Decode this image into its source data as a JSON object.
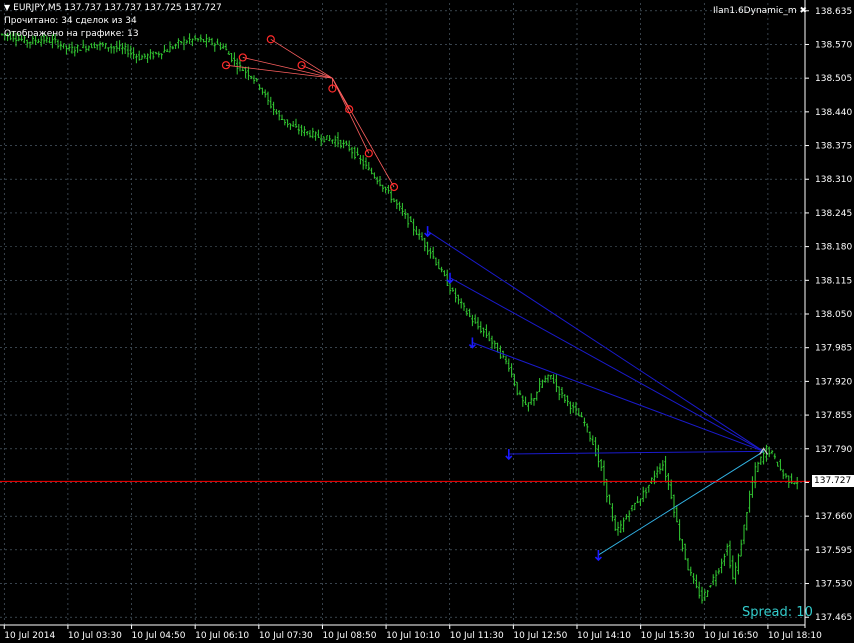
{
  "header": {
    "symbol_info": "EURJPY,M5  137.737 137.737 137.725 137.727",
    "read_info": "Прочитано: 34 сделок из 34",
    "shown_info": "Отображено на графике: 13",
    "ea_name": "Ilan1.6Dynamic_m",
    "close_symbol": "✖",
    "triangle_symbol": "▼"
  },
  "spread_text": "Spread: 10",
  "colors": {
    "background": "#000000",
    "grid": "#5a6b7a",
    "bars": "#33cc33",
    "sell_marks": "#ff2a2a",
    "buy_marks": "#1a1aff",
    "buy_lines": "#1a1acc",
    "sell_lines": "#ff6060",
    "current_price_line": "#ff0000",
    "spread_text": "#33cccc",
    "axis_text": "#ffffff"
  },
  "chart_data": {
    "type": "ohlc",
    "symbol": "EURJPY",
    "timeframe": "M5",
    "current_price": 137.727,
    "ylim": [
      137.45,
      138.65
    ],
    "y_ticks": [
      "138.635",
      "138.570",
      "138.505",
      "138.440",
      "138.375",
      "138.310",
      "138.245",
      "138.180",
      "138.115",
      "138.050",
      "137.985",
      "137.920",
      "137.855",
      "137.790",
      "137.725",
      "137.660",
      "137.595",
      "137.530",
      "137.465"
    ],
    "x_ticks": [
      "10 Jul 2014",
      "10 Jul 03:30",
      "10 Jul 04:50",
      "10 Jul 06:10",
      "10 Jul 07:30",
      "10 Jul 08:50",
      "10 Jul 10:10",
      "10 Jul 11:30",
      "10 Jul 12:50",
      "10 Jul 14:10",
      "10 Jul 15:30",
      "10 Jul 16:50",
      "10 Jul 18:10"
    ],
    "price_path": [
      [
        0,
        138.59
      ],
      [
        5,
        138.585
      ],
      [
        10,
        138.575
      ],
      [
        15,
        138.58
      ],
      [
        20,
        138.575
      ],
      [
        25,
        138.56
      ],
      [
        30,
        138.565
      ],
      [
        35,
        138.57
      ],
      [
        40,
        138.565
      ],
      [
        45,
        138.56
      ],
      [
        50,
        138.545
      ],
      [
        55,
        138.55
      ],
      [
        60,
        138.56
      ],
      [
        65,
        138.575
      ],
      [
        70,
        138.58
      ],
      [
        75,
        138.575
      ],
      [
        80,
        138.565
      ],
      [
        85,
        138.53
      ],
      [
        90,
        138.51
      ],
      [
        93,
        138.49
      ],
      [
        96,
        138.46
      ],
      [
        100,
        138.43
      ],
      [
        105,
        138.41
      ],
      [
        110,
        138.4
      ],
      [
        115,
        138.39
      ],
      [
        120,
        138.385
      ],
      [
        125,
        138.37
      ],
      [
        130,
        138.34
      ],
      [
        135,
        138.31
      ],
      [
        138,
        138.29
      ],
      [
        142,
        138.26
      ],
      [
        146,
        138.23
      ],
      [
        150,
        138.2
      ],
      [
        154,
        138.17
      ],
      [
        158,
        138.13
      ],
      [
        162,
        138.09
      ],
      [
        166,
        138.06
      ],
      [
        170,
        138.03
      ],
      [
        174,
        138.01
      ],
      [
        178,
        137.98
      ],
      [
        182,
        137.95
      ],
      [
        185,
        137.9
      ],
      [
        188,
        137.87
      ],
      [
        191,
        137.89
      ],
      [
        194,
        137.92
      ],
      [
        197,
        137.93
      ],
      [
        200,
        137.9
      ],
      [
        203,
        137.88
      ],
      [
        206,
        137.86
      ],
      [
        209,
        137.84
      ],
      [
        212,
        137.8
      ],
      [
        215,
        137.75
      ],
      [
        218,
        137.68
      ],
      [
        220,
        137.63
      ],
      [
        222,
        137.64
      ],
      [
        225,
        137.67
      ],
      [
        228,
        137.69
      ],
      [
        231,
        137.71
      ],
      [
        233,
        137.73
      ],
      [
        235,
        137.75
      ],
      [
        237,
        137.76
      ],
      [
        240,
        137.7
      ],
      [
        243,
        137.62
      ],
      [
        246,
        137.56
      ],
      [
        249,
        137.52
      ],
      [
        251,
        137.5
      ],
      [
        254,
        137.53
      ],
      [
        257,
        137.56
      ],
      [
        260,
        137.6
      ],
      [
        262,
        137.54
      ],
      [
        264,
        137.58
      ],
      [
        266,
        137.64
      ],
      [
        268,
        137.7
      ],
      [
        270,
        137.75
      ],
      [
        272,
        137.77
      ],
      [
        274,
        137.79
      ],
      [
        276,
        137.78
      ],
      [
        278,
        137.76
      ],
      [
        280,
        137.74
      ],
      [
        282,
        137.73
      ],
      [
        284,
        137.727
      ]
    ],
    "sell_orders": [
      {
        "t": 80,
        "price": 138.53
      },
      {
        "t": 86,
        "price": 138.545
      },
      {
        "t": 96,
        "price": 138.58
      },
      {
        "t": 107,
        "price": 138.53
      },
      {
        "t": 118,
        "price": 138.485
      },
      {
        "t": 124,
        "price": 138.445
      },
      {
        "t": 131,
        "price": 138.36
      },
      {
        "t": 140,
        "price": 138.295
      }
    ],
    "buy_orders": [
      {
        "t": 152,
        "price": 138.21
      },
      {
        "t": 160,
        "price": 138.12
      },
      {
        "t": 168,
        "price": 137.995
      },
      {
        "t": 181,
        "price": 137.78
      },
      {
        "t": 213,
        "price": 137.585
      }
    ],
    "sell_close": {
      "t": 118,
      "price": 138.505
    },
    "buy_close": {
      "t": 272,
      "price": 137.785
    }
  }
}
